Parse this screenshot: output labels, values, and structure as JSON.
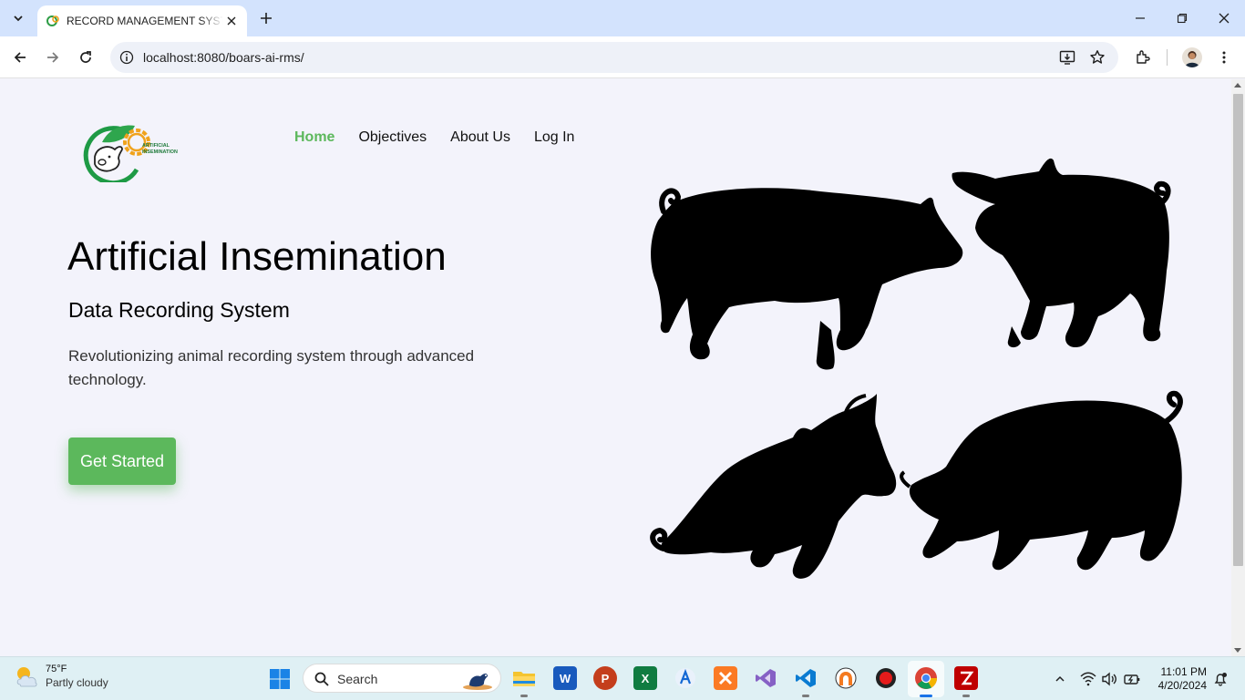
{
  "browser": {
    "tab": {
      "title": "RECORD MANAGEMENT SYSTEM",
      "favicon": "ai-logo-favicon"
    },
    "address": {
      "url": "localhost:8080/boars-ai-rms/"
    },
    "icons": [
      "tab-search-icon",
      "close-icon",
      "new-tab-icon",
      "minimize-icon",
      "restore-icon",
      "window-close-icon",
      "back-icon",
      "forward-icon",
      "reload-icon",
      "site-info-icon",
      "install-app-icon",
      "bookmark-star-icon",
      "extensions-icon",
      "profile-avatar",
      "menu-kebab-icon"
    ]
  },
  "page": {
    "logo_text_1": "ARTIFICIAL",
    "logo_text_2": "INSEMINATION",
    "nav": [
      {
        "label": "Home",
        "active": true
      },
      {
        "label": "Objectives",
        "active": false
      },
      {
        "label": "About Us",
        "active": false
      },
      {
        "label": "Log In",
        "active": false
      }
    ],
    "hero": {
      "title": "Artificial Insemination",
      "subtitle": "Data Recording System",
      "description": "Revolutionizing animal recording system through advanced technology.",
      "cta_label": "Get Started"
    },
    "colors": {
      "accent": "#5cb85c",
      "background": "#f3f3fb",
      "silhouette": "#000000"
    }
  },
  "taskbar": {
    "weather": {
      "temp": "75°F",
      "desc": "Partly cloudy"
    },
    "search_placeholder": "Search",
    "apps": [
      "file-explorer",
      "word",
      "powerpoint",
      "excel",
      "app-installer",
      "xampp",
      "visual-studio",
      "vscode",
      "scrcpy-app",
      "obs-record",
      "chrome",
      "filezilla"
    ],
    "clock": {
      "time": "11:01 PM",
      "date": "4/20/2024"
    }
  }
}
